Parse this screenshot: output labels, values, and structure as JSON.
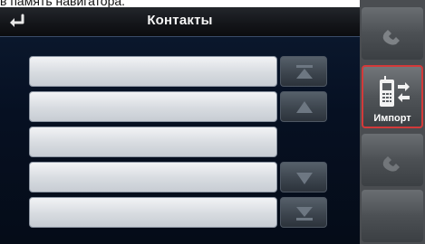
{
  "caption": "в память навигатора.",
  "header": {
    "title": "Контакты"
  },
  "contacts": {
    "rows": [
      "",
      "",
      "",
      "",
      ""
    ]
  },
  "nav": {
    "icons": [
      "skip-to-top-icon",
      "scroll-up-icon",
      "scroll-down-icon",
      "skip-to-bottom-icon"
    ]
  },
  "sidebar": {
    "import_label": "Импорт",
    "import_icon": "phone-import-icon",
    "accent_color": "#d33a3a"
  }
}
